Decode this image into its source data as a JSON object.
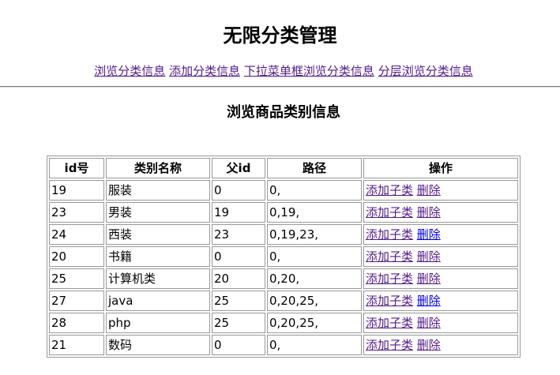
{
  "page_title": "无限分类管理",
  "nav_links": [
    "浏览分类信息",
    "添加分类信息",
    "下拉菜单框浏览分类信息",
    "分层浏览分类信息"
  ],
  "section_title": "浏览商品类别信息",
  "table": {
    "headers": [
      "id号",
      "类别名称",
      "父id",
      "路径",
      "操作"
    ],
    "rows": [
      {
        "id": "19",
        "name": "服装",
        "pid": "0",
        "path": "0,"
      },
      {
        "id": "23",
        "name": "男装",
        "pid": "19",
        "path": "0,19,"
      },
      {
        "id": "24",
        "name": "西装",
        "pid": "23",
        "path": "0,19,23,"
      },
      {
        "id": "20",
        "name": "书籍",
        "pid": "0",
        "path": "0,"
      },
      {
        "id": "25",
        "name": "计算机类",
        "pid": "20",
        "path": "0,20,"
      },
      {
        "id": "27",
        "name": "java",
        "pid": "25",
        "path": "0,20,25,"
      },
      {
        "id": "28",
        "name": "php",
        "pid": "25",
        "path": "0,20,25,"
      },
      {
        "id": "21",
        "name": "数码",
        "pid": "0",
        "path": "0,"
      }
    ],
    "actions": {
      "add_child": "添加子类",
      "delete": "删除"
    }
  },
  "colors": {
    "visited_link": "#551a8b",
    "link": "#0000ee"
  }
}
